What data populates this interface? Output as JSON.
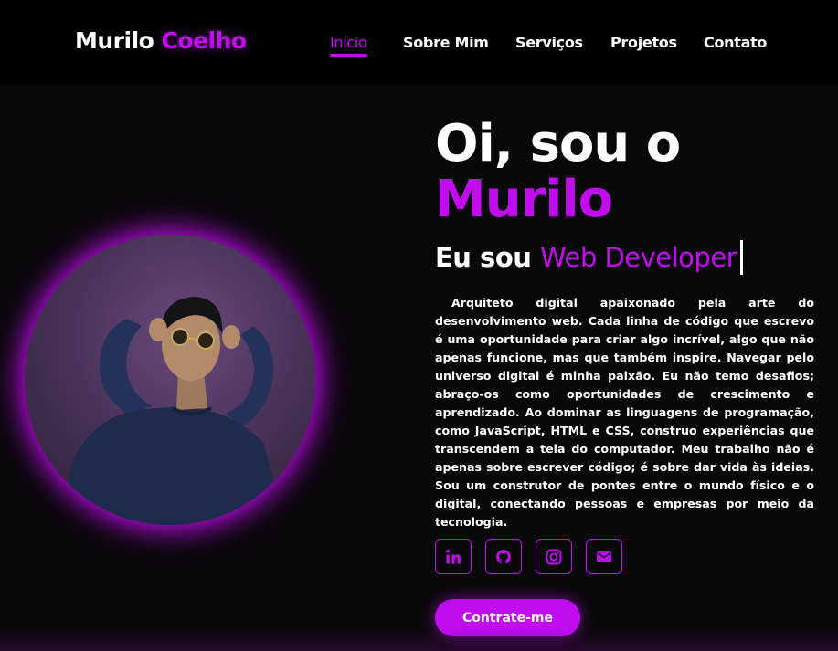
{
  "header": {
    "logo_first": "Murilo",
    "logo_second": "Coelho",
    "nav": [
      {
        "label": "Início",
        "active": true
      },
      {
        "label": "Sobre Mim",
        "active": false
      },
      {
        "label": "Serviços",
        "active": false
      },
      {
        "label": "Projetos",
        "active": false
      },
      {
        "label": "Contato",
        "active": false
      }
    ]
  },
  "hero": {
    "greeting": "Oi, sou o",
    "name": "Murilo",
    "role_prefix": "Eu sou",
    "role_typed": "Web Developer",
    "bio": "Arquiteto digital apaixonado pela arte do desenvolvimento web. Cada linha de código que escrevo é uma oportunidade para criar algo incrível, algo que não apenas funcione, mas que também inspire. Navegar pelo universo digital é minha paixão. Eu não temo desafios; abraço-os como oportunidades de crescimento e aprendizado. Ao dominar as linguagens de programação, como JavaScript, HTML e CSS, construo experiências que transcendem a tela do computador. Meu trabalho não é apenas sobre escrever código; é sobre dar vida às ideias. Sou um construtor de pontes entre o mundo físico e o digital, conectando pessoas e empresas por meio da tecnologia.",
    "socials": [
      {
        "icon": "linkedin-icon"
      },
      {
        "icon": "github-icon"
      },
      {
        "icon": "instagram-icon"
      },
      {
        "icon": "email-icon"
      }
    ],
    "cta_label": "Contrate-me"
  },
  "colors": {
    "accent": "#c10cf0",
    "background": "#080808",
    "header_background": "#000000",
    "text": "#ffffff"
  }
}
